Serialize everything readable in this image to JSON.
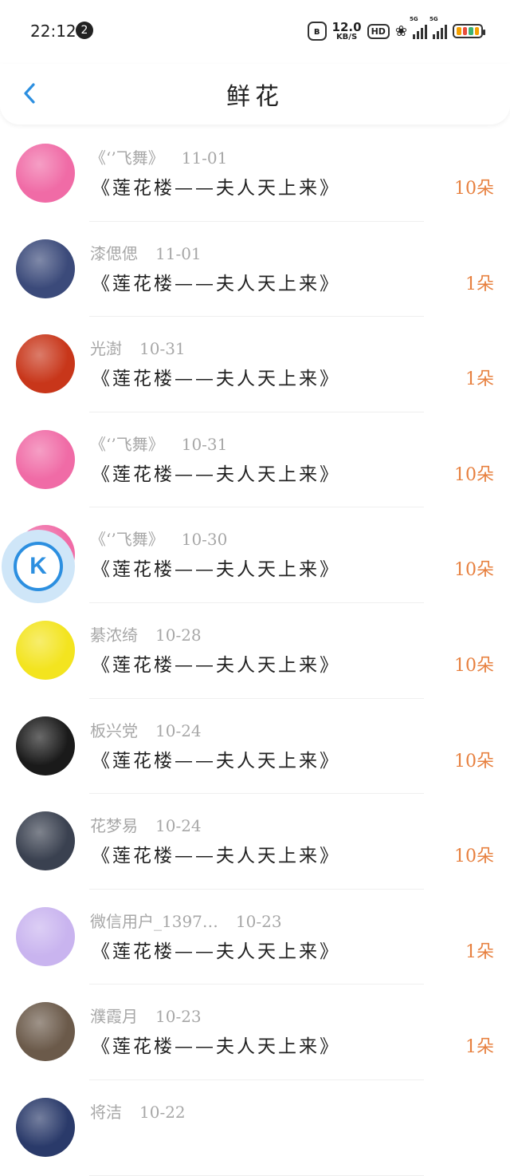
{
  "status": {
    "time": "22:12",
    "notif_count": "2",
    "speed_value": "12.0",
    "speed_unit": "KB/S",
    "hd": "HD",
    "net1": "5G",
    "net2": "5G"
  },
  "header": {
    "title": "鲜花"
  },
  "rows": [
    {
      "name": "《‘’飞舞》",
      "date": "11-01",
      "gift": "《莲花楼——夫人天上来》",
      "qty": "10朵",
      "avatar_color": "#f06ba6"
    },
    {
      "name": "漆偲偲",
      "date": "11-01",
      "gift": "《莲花楼——夫人天上来》",
      "qty": "1朵",
      "avatar_color": "#3b4a7a"
    },
    {
      "name": "光澍",
      "date": "10-31",
      "gift": "《莲花楼——夫人天上来》",
      "qty": "1朵",
      "avatar_color": "#c8361a"
    },
    {
      "name": "《‘’飞舞》",
      "date": "10-31",
      "gift": "《莲花楼——夫人天上来》",
      "qty": "10朵",
      "avatar_color": "#f06ba6"
    },
    {
      "name": "《‘’飞舞》",
      "date": "10-30",
      "gift": "《莲花楼——夫人天上来》",
      "qty": "10朵",
      "avatar_color": "#f06ba6"
    },
    {
      "name": "綦浓绮",
      "date": "10-28",
      "gift": "《莲花楼——夫人天上来》",
      "qty": "10朵",
      "avatar_color": "#f3e41f"
    },
    {
      "name": "板兴党",
      "date": "10-24",
      "gift": "《莲花楼——夫人天上来》",
      "qty": "10朵",
      "avatar_color": "#1a1a1a"
    },
    {
      "name": "花梦易",
      "date": "10-24",
      "gift": "《莲花楼——夫人天上来》",
      "qty": "10朵",
      "avatar_color": "#3a4150"
    },
    {
      "name": "微信用户_1397…",
      "date": "10-23",
      "gift": "《莲花楼——夫人天上来》",
      "qty": "1朵",
      "avatar_color": "#c9b4ef"
    },
    {
      "name": "濮霞月",
      "date": "10-23",
      "gift": "《莲花楼——夫人天上来》",
      "qty": "1朵",
      "avatar_color": "#6b5a4a"
    },
    {
      "name": "将洁",
      "date": "10-22",
      "gift": "",
      "qty": "",
      "avatar_color": "#2a3a6a"
    }
  ],
  "floating_icon": "K",
  "colors": {
    "accent": "#2c8fe0",
    "qty": "#e7803f",
    "muted": "#a7a7a7"
  }
}
